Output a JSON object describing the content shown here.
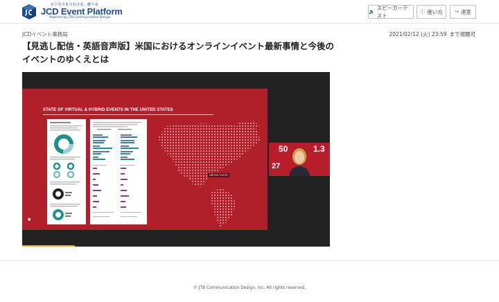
{
  "header": {
    "logo_tagline": "ビジネスをつなげる、統べる",
    "logo_name": "JCD Event Platform",
    "logo_sub": "Powered by JTB Communication Design",
    "buttons": [
      {
        "label": "スピーカーテスト",
        "icon": "speaker-icon"
      },
      {
        "label": "使い方",
        "icon": "help-icon"
      },
      {
        "label": "退室",
        "icon": "exit-icon"
      }
    ]
  },
  "event": {
    "category": "JCDイベント事務局",
    "availability_date": "2021/02/12 (火) 23:59",
    "availability_suffix": "まで視聴可",
    "title": "【見逃し配信・英語音声版】米国におけるオンラインイベント最新事情と今後のイベントのゆくえとは"
  },
  "video": {
    "slide_title": "STATE OF VIRTUAL & HYBRID EVENTS IN THE UNITED STATES",
    "map_label": "UNITED STATES",
    "speaker_stats": [
      "50",
      "27",
      "1.3"
    ]
  },
  "footer": {
    "copyright": "© JTB Communication Design, Inc. All rights reserved."
  },
  "colors": {
    "brand": "#1d4d8f",
    "slide_red": "#b11f2b",
    "progress": "#e8a23a"
  }
}
